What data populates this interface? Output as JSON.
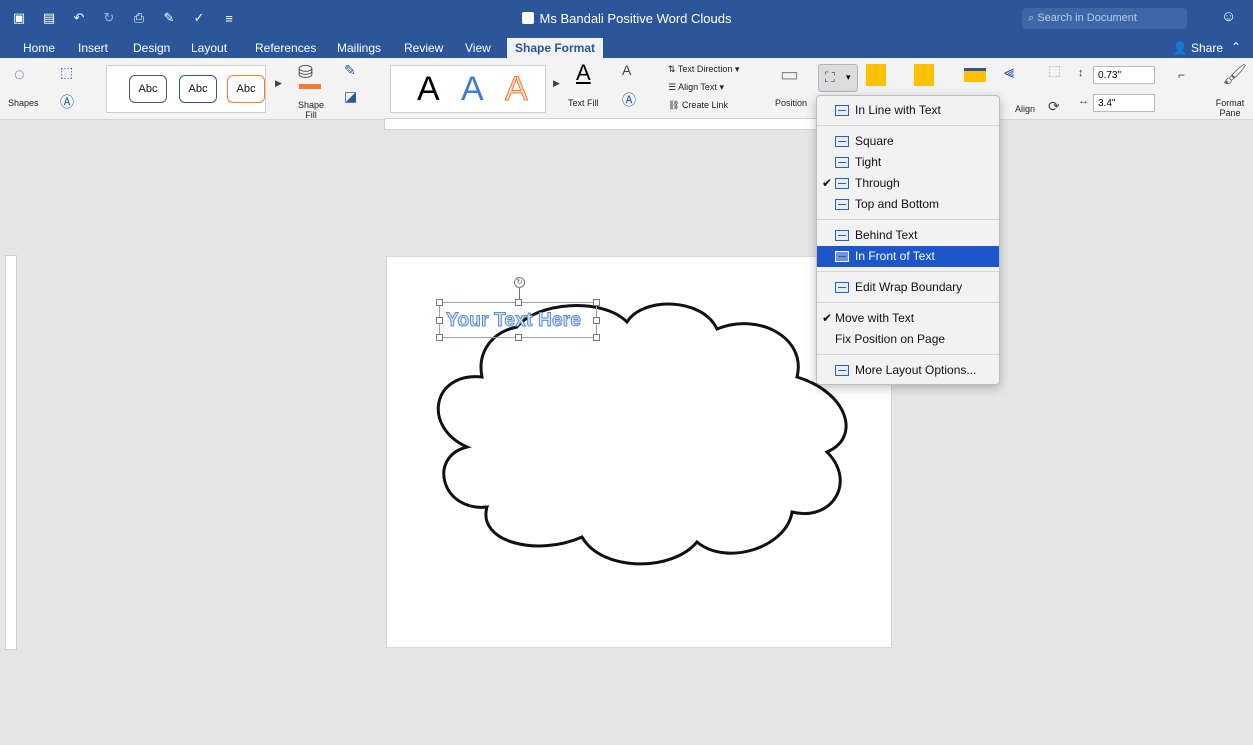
{
  "app": {
    "doc_title": "Ms Bandali Positive Word Clouds",
    "search_placeholder": "Search in Document"
  },
  "tabs": [
    {
      "label": "Home"
    },
    {
      "label": "Insert"
    },
    {
      "label": "Design"
    },
    {
      "label": "Layout"
    },
    {
      "label": "References"
    },
    {
      "label": "Mailings"
    },
    {
      "label": "Review"
    },
    {
      "label": "View"
    },
    {
      "label": "Shape Format"
    }
  ],
  "share_label": "Share",
  "ribbon": {
    "shapes_label": "Shapes",
    "style_abc": "Abc",
    "shape_fill_label": "Shape Fill",
    "text_fill_label": "Text Fill",
    "text_direction": "Text Direction",
    "align_text": "Align Text",
    "create_link": "Create Link",
    "position_label": "Position",
    "align_label": "Align",
    "height_value": "0.73\"",
    "width_value": "3.4\"",
    "format_pane_label": "Format Pane",
    "bigA": "A"
  },
  "canvas": {
    "wordart_text": "Your Text Here"
  },
  "wrap_menu": {
    "items": [
      {
        "label": "In Line with Text",
        "checked": false,
        "highlighted": false
      },
      {
        "label": "Square",
        "checked": false,
        "highlighted": false
      },
      {
        "label": "Tight",
        "checked": false,
        "highlighted": false
      },
      {
        "label": "Through",
        "checked": true,
        "highlighted": false
      },
      {
        "label": "Top and Bottom",
        "checked": false,
        "highlighted": false
      },
      {
        "label": "Behind Text",
        "checked": false,
        "highlighted": false
      },
      {
        "label": "In Front of Text",
        "checked": false,
        "highlighted": true
      },
      {
        "label": "Edit Wrap Boundary",
        "checked": false,
        "highlighted": false
      },
      {
        "label": "Move with Text",
        "checked": true,
        "highlighted": false
      },
      {
        "label": "Fix Position on Page",
        "checked": false,
        "highlighted": false
      },
      {
        "label": "More Layout Options...",
        "checked": false,
        "highlighted": false
      }
    ]
  },
  "colors": {
    "accent": "#2b579a",
    "menu_highlight": "#1d56c8",
    "wordart_outline": "#5b8bd1",
    "shape_fill_orange": "#ed7d31",
    "shape_yellow": "#ffc000"
  }
}
